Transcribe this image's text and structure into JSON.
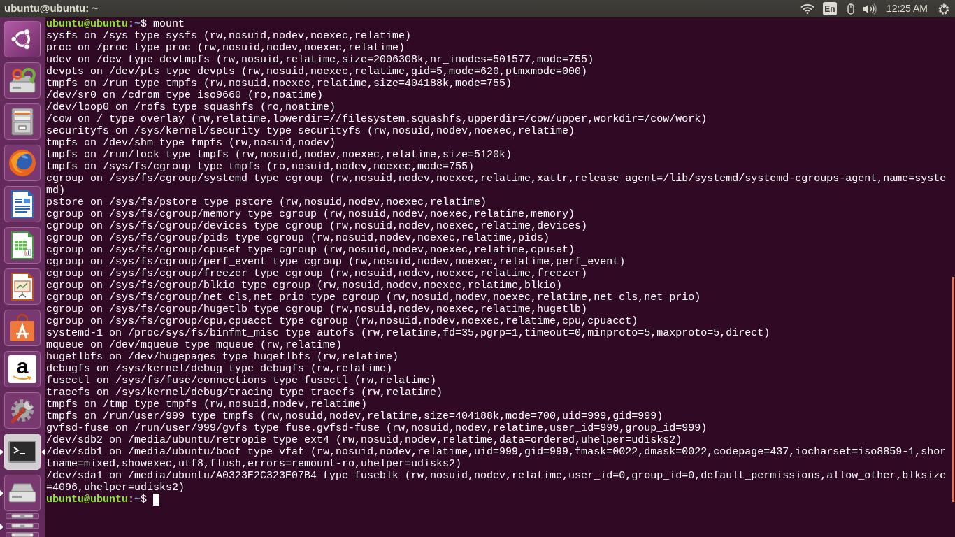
{
  "top_panel": {
    "window_title": "ubuntu@ubuntu: ~",
    "keyboard_layout": "En",
    "clock": "12:25 AM"
  },
  "launcher": {
    "items": [
      {
        "kind": "dash",
        "running": false,
        "focused": false,
        "folded": false
      },
      {
        "kind": "installer",
        "running": false,
        "focused": false,
        "folded": false
      },
      {
        "kind": "files",
        "running": false,
        "focused": false,
        "folded": false
      },
      {
        "kind": "browser",
        "running": false,
        "focused": false,
        "folded": false
      },
      {
        "kind": "writer",
        "running": false,
        "focused": false,
        "folded": false
      },
      {
        "kind": "spreadsheet",
        "running": false,
        "focused": false,
        "folded": false
      },
      {
        "kind": "presentation",
        "running": false,
        "focused": false,
        "folded": false
      },
      {
        "kind": "store",
        "running": false,
        "focused": false,
        "folded": false
      },
      {
        "kind": "shop",
        "logo_text": "a",
        "running": false,
        "focused": false,
        "folded": false
      },
      {
        "kind": "settings",
        "running": false,
        "focused": false,
        "folded": false
      },
      {
        "kind": "terminal",
        "running": true,
        "focused": true,
        "folded": false
      },
      {
        "kind": "drive",
        "running": true,
        "focused": false,
        "folded": false
      },
      {
        "kind": "usb",
        "running": false,
        "focused": false,
        "folded": true
      },
      {
        "kind": "usb",
        "running": true,
        "focused": false,
        "folded": true
      },
      {
        "kind": "trash",
        "running": false,
        "focused": false,
        "folded": true
      }
    ]
  },
  "terminal": {
    "lines": [
      {
        "kind": "prompt",
        "user_host": "ubuntu@ubuntu",
        "separator": ":",
        "path": "~",
        "symbol": "$",
        "command": "mount",
        "cursor": false
      },
      {
        "kind": "output",
        "text": "sysfs on /sys type sysfs (rw,nosuid,nodev,noexec,relatime)"
      },
      {
        "kind": "output",
        "text": "proc on /proc type proc (rw,nosuid,nodev,noexec,relatime)"
      },
      {
        "kind": "output",
        "text": "udev on /dev type devtmpfs (rw,nosuid,relatime,size=2006308k,nr_inodes=501577,mode=755)"
      },
      {
        "kind": "output",
        "text": "devpts on /dev/pts type devpts (rw,nosuid,noexec,relatime,gid=5,mode=620,ptmxmode=000)"
      },
      {
        "kind": "output",
        "text": "tmpfs on /run type tmpfs (rw,nosuid,noexec,relatime,size=404188k,mode=755)"
      },
      {
        "kind": "output",
        "text": "/dev/sr0 on /cdrom type iso9660 (ro,noatime)"
      },
      {
        "kind": "output",
        "text": "/dev/loop0 on /rofs type squashfs (ro,noatime)"
      },
      {
        "kind": "output",
        "text": "/cow on / type overlay (rw,relatime,lowerdir=//filesystem.squashfs,upperdir=/cow/upper,workdir=/cow/work)"
      },
      {
        "kind": "output",
        "text": "securityfs on /sys/kernel/security type securityfs (rw,nosuid,nodev,noexec,relatime)"
      },
      {
        "kind": "output",
        "text": "tmpfs on /dev/shm type tmpfs (rw,nosuid,nodev)"
      },
      {
        "kind": "output",
        "text": "tmpfs on /run/lock type tmpfs (rw,nosuid,nodev,noexec,relatime,size=5120k)"
      },
      {
        "kind": "output",
        "text": "tmpfs on /sys/fs/cgroup type tmpfs (ro,nosuid,nodev,noexec,mode=755)"
      },
      {
        "kind": "output",
        "text": "cgroup on /sys/fs/cgroup/systemd type cgroup (rw,nosuid,nodev,noexec,relatime,xattr,release_agent=/lib/systemd/systemd-cgroups-agent,name=systemd)"
      },
      {
        "kind": "output",
        "text": "pstore on /sys/fs/pstore type pstore (rw,nosuid,nodev,noexec,relatime)"
      },
      {
        "kind": "output",
        "text": "cgroup on /sys/fs/cgroup/memory type cgroup (rw,nosuid,nodev,noexec,relatime,memory)"
      },
      {
        "kind": "output",
        "text": "cgroup on /sys/fs/cgroup/devices type cgroup (rw,nosuid,nodev,noexec,relatime,devices)"
      },
      {
        "kind": "output",
        "text": "cgroup on /sys/fs/cgroup/pids type cgroup (rw,nosuid,nodev,noexec,relatime,pids)"
      },
      {
        "kind": "output",
        "text": "cgroup on /sys/fs/cgroup/cpuset type cgroup (rw,nosuid,nodev,noexec,relatime,cpuset)"
      },
      {
        "kind": "output",
        "text": "cgroup on /sys/fs/cgroup/perf_event type cgroup (rw,nosuid,nodev,noexec,relatime,perf_event)"
      },
      {
        "kind": "output",
        "text": "cgroup on /sys/fs/cgroup/freezer type cgroup (rw,nosuid,nodev,noexec,relatime,freezer)"
      },
      {
        "kind": "output",
        "text": "cgroup on /sys/fs/cgroup/blkio type cgroup (rw,nosuid,nodev,noexec,relatime,blkio)"
      },
      {
        "kind": "output",
        "text": "cgroup on /sys/fs/cgroup/net_cls,net_prio type cgroup (rw,nosuid,nodev,noexec,relatime,net_cls,net_prio)"
      },
      {
        "kind": "output",
        "text": "cgroup on /sys/fs/cgroup/hugetlb type cgroup (rw,nosuid,nodev,noexec,relatime,hugetlb)"
      },
      {
        "kind": "output",
        "text": "cgroup on /sys/fs/cgroup/cpu,cpuacct type cgroup (rw,nosuid,nodev,noexec,relatime,cpu,cpuacct)"
      },
      {
        "kind": "output",
        "text": "systemd-1 on /proc/sys/fs/binfmt_misc type autofs (rw,relatime,fd=35,pgrp=1,timeout=0,minproto=5,maxproto=5,direct)"
      },
      {
        "kind": "output",
        "text": "mqueue on /dev/mqueue type mqueue (rw,relatime)"
      },
      {
        "kind": "output",
        "text": "hugetlbfs on /dev/hugepages type hugetlbfs (rw,relatime)"
      },
      {
        "kind": "output",
        "text": "debugfs on /sys/kernel/debug type debugfs (rw,relatime)"
      },
      {
        "kind": "output",
        "text": "fusectl on /sys/fs/fuse/connections type fusectl (rw,relatime)"
      },
      {
        "kind": "output",
        "text": "tracefs on /sys/kernel/debug/tracing type tracefs (rw,relatime)"
      },
      {
        "kind": "output",
        "text": "tmpfs on /tmp type tmpfs (rw,nosuid,nodev,relatime)"
      },
      {
        "kind": "output",
        "text": "tmpfs on /run/user/999 type tmpfs (rw,nosuid,nodev,relatime,size=404188k,mode=700,uid=999,gid=999)"
      },
      {
        "kind": "output",
        "text": "gvfsd-fuse on /run/user/999/gvfs type fuse.gvfsd-fuse (rw,nosuid,nodev,relatime,user_id=999,group_id=999)"
      },
      {
        "kind": "output",
        "text": "/dev/sdb2 on /media/ubuntu/retropie type ext4 (rw,nosuid,nodev,relatime,data=ordered,uhelper=udisks2)"
      },
      {
        "kind": "output",
        "text": "/dev/sdb1 on /media/ubuntu/boot type vfat (rw,nosuid,nodev,relatime,uid=999,gid=999,fmask=0022,dmask=0022,codepage=437,iocharset=iso8859-1,shortname=mixed,showexec,utf8,flush,errors=remount-ro,uhelper=udisks2)"
      },
      {
        "kind": "output",
        "text": "/dev/sda1 on /media/ubuntu/A0323E2C323E07B4 type fuseblk (rw,nosuid,nodev,relatime,user_id=0,group_id=0,default_permissions,allow_other,blksize=4096,uhelper=udisks2)"
      },
      {
        "kind": "prompt",
        "user_host": "ubuntu@ubuntu",
        "separator": ":",
        "path": "~",
        "symbol": "$",
        "cursor": true
      }
    ]
  }
}
